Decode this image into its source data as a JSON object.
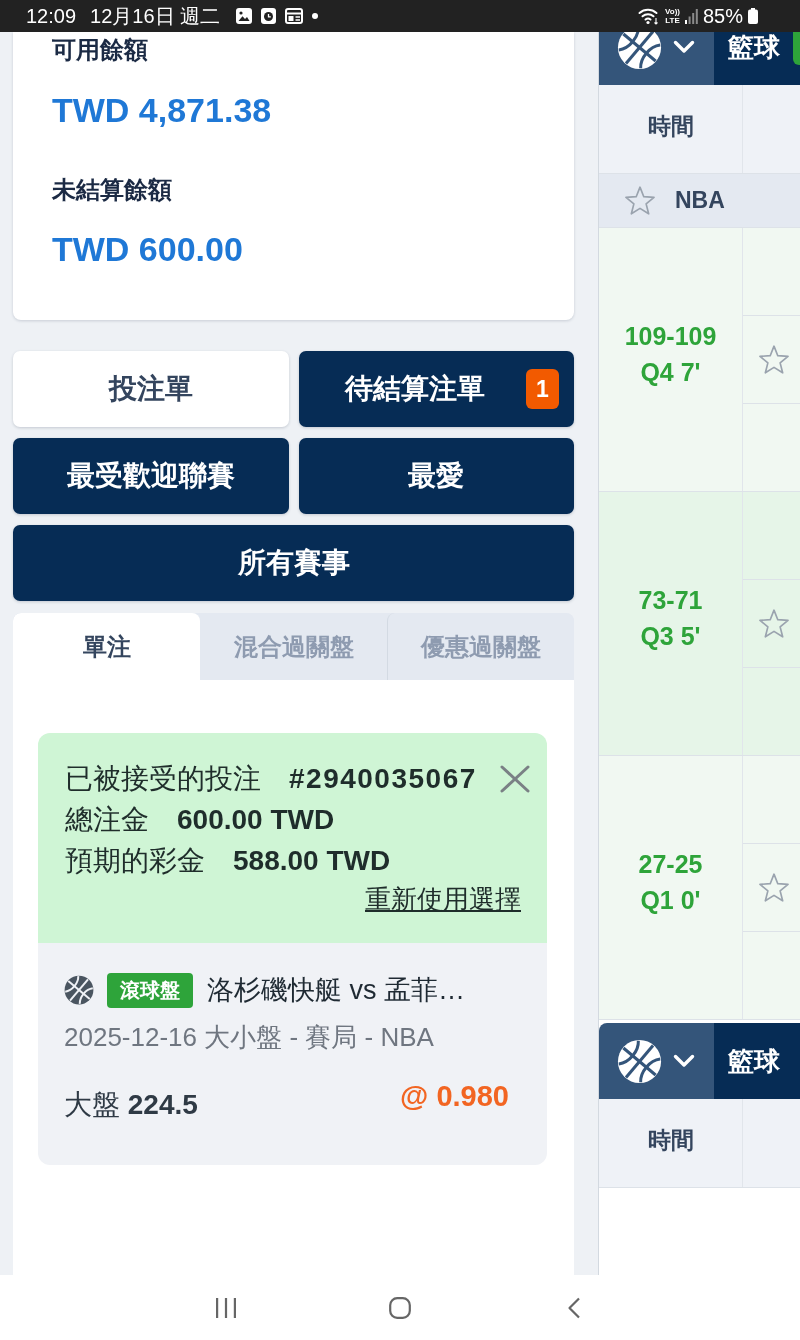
{
  "status_bar": {
    "time": "12:09",
    "date": "12月16日 週二",
    "network": [
      "Vo))",
      "LTE"
    ],
    "battery": "85%"
  },
  "balance": [
    {
      "label": "可用餘額",
      "amount": "TWD 4,871.38"
    },
    {
      "label": "未結算餘額",
      "amount": "TWD 600.00"
    }
  ],
  "nav_buttons": [
    {
      "label": "投注單",
      "selected": true
    },
    {
      "label": "待結算注單",
      "selected": false,
      "badge": "1"
    },
    {
      "label": "最受歡迎聯賽",
      "selected": false
    },
    {
      "label": "最愛",
      "selected": false
    },
    {
      "label": "所有賽事",
      "selected": false
    }
  ],
  "bet_tabs": [
    {
      "label": "單注",
      "selected": true
    },
    {
      "label": "混合過關盤",
      "selected": false
    },
    {
      "label": "優惠過關盤",
      "selected": false
    }
  ],
  "bet_receipt": {
    "title": "已被接受的投注",
    "bet_id": "#2940035067",
    "rows": [
      {
        "label": "總注金",
        "value": "600.00 TWD"
      },
      {
        "label": "預期的彩金",
        "value": "588.00 TWD"
      }
    ],
    "reuse_link": "重新使用選擇",
    "selection": {
      "live_badge": "滾球盤",
      "match": "洛杉磯快艇 vs 孟菲…",
      "details": "2025-12-16 大小盤 - 賽局 - NBA",
      "pick": "大盤 **224.5**",
      "odds": "@ 0.980"
    }
  },
  "sports_panel": {
    "sections": [
      {
        "title": "籃球",
        "live": true,
        "time_header": "時間",
        "leagues": [
          {
            "name": "NBA",
            "favorite": false,
            "matches": [
              {
                "score": "109-109",
                "period": "Q4 7'",
                "favorite": false
              },
              {
                "score": "73-71",
                "period": "Q3 5'",
                "favorite": false
              },
              {
                "score": "27-25",
                "period": "Q1 0'",
                "favorite": false
              }
            ]
          }
        ]
      },
      {
        "title": "籃球",
        "live": false,
        "time_header": "時間"
      }
    ]
  }
}
